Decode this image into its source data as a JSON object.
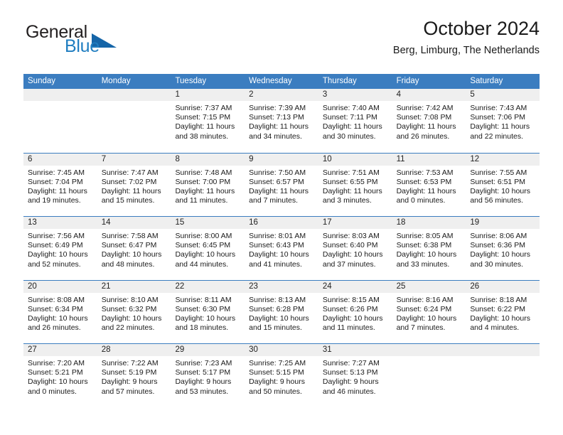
{
  "brand": {
    "name_part1": "General",
    "name_part2": "Blue",
    "accent_color": "#1565a8",
    "text_color": "#231f20"
  },
  "header": {
    "title": "October 2024",
    "subtitle": "Berg, Limburg, The Netherlands"
  },
  "calendar": {
    "header_bg": "#3b7dc0",
    "date_band_bg": "#efefef",
    "weekdays": [
      "Sunday",
      "Monday",
      "Tuesday",
      "Wednesday",
      "Thursday",
      "Friday",
      "Saturday"
    ],
    "weeks": [
      [
        {
          "day": "",
          "empty": true
        },
        {
          "day": "",
          "empty": true
        },
        {
          "day": "1",
          "sunrise": "Sunrise: 7:37 AM",
          "sunset": "Sunset: 7:15 PM",
          "daylight": "Daylight: 11 hours and 38 minutes."
        },
        {
          "day": "2",
          "sunrise": "Sunrise: 7:39 AM",
          "sunset": "Sunset: 7:13 PM",
          "daylight": "Daylight: 11 hours and 34 minutes."
        },
        {
          "day": "3",
          "sunrise": "Sunrise: 7:40 AM",
          "sunset": "Sunset: 7:11 PM",
          "daylight": "Daylight: 11 hours and 30 minutes."
        },
        {
          "day": "4",
          "sunrise": "Sunrise: 7:42 AM",
          "sunset": "Sunset: 7:08 PM",
          "daylight": "Daylight: 11 hours and 26 minutes."
        },
        {
          "day": "5",
          "sunrise": "Sunrise: 7:43 AM",
          "sunset": "Sunset: 7:06 PM",
          "daylight": "Daylight: 11 hours and 22 minutes."
        }
      ],
      [
        {
          "day": "6",
          "sunrise": "Sunrise: 7:45 AM",
          "sunset": "Sunset: 7:04 PM",
          "daylight": "Daylight: 11 hours and 19 minutes."
        },
        {
          "day": "7",
          "sunrise": "Sunrise: 7:47 AM",
          "sunset": "Sunset: 7:02 PM",
          "daylight": "Daylight: 11 hours and 15 minutes."
        },
        {
          "day": "8",
          "sunrise": "Sunrise: 7:48 AM",
          "sunset": "Sunset: 7:00 PM",
          "daylight": "Daylight: 11 hours and 11 minutes."
        },
        {
          "day": "9",
          "sunrise": "Sunrise: 7:50 AM",
          "sunset": "Sunset: 6:57 PM",
          "daylight": "Daylight: 11 hours and 7 minutes."
        },
        {
          "day": "10",
          "sunrise": "Sunrise: 7:51 AM",
          "sunset": "Sunset: 6:55 PM",
          "daylight": "Daylight: 11 hours and 3 minutes."
        },
        {
          "day": "11",
          "sunrise": "Sunrise: 7:53 AM",
          "sunset": "Sunset: 6:53 PM",
          "daylight": "Daylight: 11 hours and 0 minutes."
        },
        {
          "day": "12",
          "sunrise": "Sunrise: 7:55 AM",
          "sunset": "Sunset: 6:51 PM",
          "daylight": "Daylight: 10 hours and 56 minutes."
        }
      ],
      [
        {
          "day": "13",
          "sunrise": "Sunrise: 7:56 AM",
          "sunset": "Sunset: 6:49 PM",
          "daylight": "Daylight: 10 hours and 52 minutes."
        },
        {
          "day": "14",
          "sunrise": "Sunrise: 7:58 AM",
          "sunset": "Sunset: 6:47 PM",
          "daylight": "Daylight: 10 hours and 48 minutes."
        },
        {
          "day": "15",
          "sunrise": "Sunrise: 8:00 AM",
          "sunset": "Sunset: 6:45 PM",
          "daylight": "Daylight: 10 hours and 44 minutes."
        },
        {
          "day": "16",
          "sunrise": "Sunrise: 8:01 AM",
          "sunset": "Sunset: 6:43 PM",
          "daylight": "Daylight: 10 hours and 41 minutes."
        },
        {
          "day": "17",
          "sunrise": "Sunrise: 8:03 AM",
          "sunset": "Sunset: 6:40 PM",
          "daylight": "Daylight: 10 hours and 37 minutes."
        },
        {
          "day": "18",
          "sunrise": "Sunrise: 8:05 AM",
          "sunset": "Sunset: 6:38 PM",
          "daylight": "Daylight: 10 hours and 33 minutes."
        },
        {
          "day": "19",
          "sunrise": "Sunrise: 8:06 AM",
          "sunset": "Sunset: 6:36 PM",
          "daylight": "Daylight: 10 hours and 30 minutes."
        }
      ],
      [
        {
          "day": "20",
          "sunrise": "Sunrise: 8:08 AM",
          "sunset": "Sunset: 6:34 PM",
          "daylight": "Daylight: 10 hours and 26 minutes."
        },
        {
          "day": "21",
          "sunrise": "Sunrise: 8:10 AM",
          "sunset": "Sunset: 6:32 PM",
          "daylight": "Daylight: 10 hours and 22 minutes."
        },
        {
          "day": "22",
          "sunrise": "Sunrise: 8:11 AM",
          "sunset": "Sunset: 6:30 PM",
          "daylight": "Daylight: 10 hours and 18 minutes."
        },
        {
          "day": "23",
          "sunrise": "Sunrise: 8:13 AM",
          "sunset": "Sunset: 6:28 PM",
          "daylight": "Daylight: 10 hours and 15 minutes."
        },
        {
          "day": "24",
          "sunrise": "Sunrise: 8:15 AM",
          "sunset": "Sunset: 6:26 PM",
          "daylight": "Daylight: 10 hours and 11 minutes."
        },
        {
          "day": "25",
          "sunrise": "Sunrise: 8:16 AM",
          "sunset": "Sunset: 6:24 PM",
          "daylight": "Daylight: 10 hours and 7 minutes."
        },
        {
          "day": "26",
          "sunrise": "Sunrise: 8:18 AM",
          "sunset": "Sunset: 6:22 PM",
          "daylight": "Daylight: 10 hours and 4 minutes."
        }
      ],
      [
        {
          "day": "27",
          "sunrise": "Sunrise: 7:20 AM",
          "sunset": "Sunset: 5:21 PM",
          "daylight": "Daylight: 10 hours and 0 minutes."
        },
        {
          "day": "28",
          "sunrise": "Sunrise: 7:22 AM",
          "sunset": "Sunset: 5:19 PM",
          "daylight": "Daylight: 9 hours and 57 minutes."
        },
        {
          "day": "29",
          "sunrise": "Sunrise: 7:23 AM",
          "sunset": "Sunset: 5:17 PM",
          "daylight": "Daylight: 9 hours and 53 minutes."
        },
        {
          "day": "30",
          "sunrise": "Sunrise: 7:25 AM",
          "sunset": "Sunset: 5:15 PM",
          "daylight": "Daylight: 9 hours and 50 minutes."
        },
        {
          "day": "31",
          "sunrise": "Sunrise: 7:27 AM",
          "sunset": "Sunset: 5:13 PM",
          "daylight": "Daylight: 9 hours and 46 minutes."
        },
        {
          "day": "",
          "empty": true
        },
        {
          "day": "",
          "empty": true
        }
      ]
    ]
  }
}
